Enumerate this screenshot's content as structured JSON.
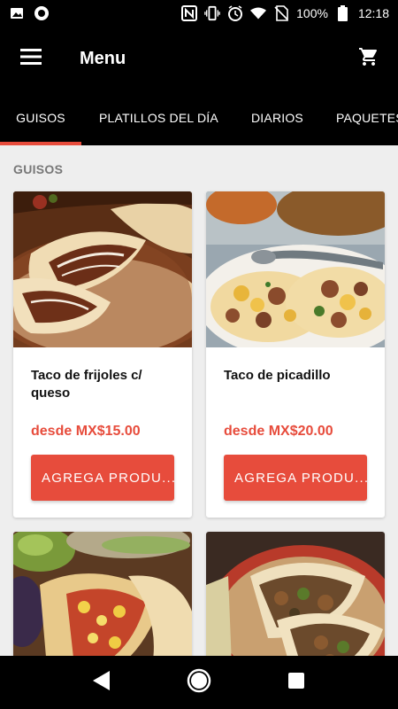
{
  "status_bar": {
    "battery": "100%",
    "time": "12:18",
    "icons": [
      "image-icon",
      "circle-icon",
      "nfc-icon",
      "vibrate-icon",
      "alarm-icon",
      "wifi-icon",
      "no-sim-icon",
      "battery-icon"
    ]
  },
  "app_bar": {
    "title": "Menu",
    "menu_icon": "hamburger-menu-icon",
    "cart_icon": "shopping-cart-icon"
  },
  "tabs": [
    {
      "label": "GUISOS",
      "active": true
    },
    {
      "label": "PLATILLOS DEL DÍA",
      "active": false
    },
    {
      "label": "DIARIOS",
      "active": false
    },
    {
      "label": "PAQUETES",
      "active": false
    }
  ],
  "section": {
    "title": "GUISOS"
  },
  "products": [
    {
      "name": "Taco de frijoles c/ queso",
      "price": "desde MX$15.00",
      "button": "AGREGA PRODU..."
    },
    {
      "name": "Taco de picadillo",
      "price": "desde MX$20.00",
      "button": "AGREGA PRODU..."
    },
    {
      "name": "",
      "price": "",
      "button": ""
    },
    {
      "name": "",
      "price": "",
      "button": ""
    }
  ],
  "colors": {
    "accent": "#e74c3c",
    "bar": "#000000",
    "background": "#eeeeee"
  },
  "nav_bar": {
    "icons": [
      "back-icon",
      "home-icon",
      "recents-icon"
    ]
  }
}
